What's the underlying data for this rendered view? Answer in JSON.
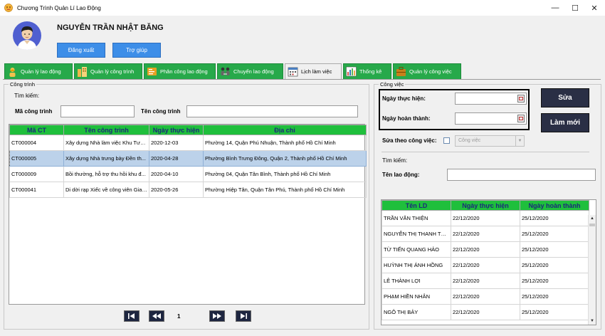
{
  "window": {
    "title": "Chương Trình Quản Lí Lao Động",
    "minimize": "—",
    "maximize": "☐",
    "close": "✕"
  },
  "header": {
    "user_name": "NGUYỄN TRẦN NHẬT BĂNG",
    "logout_label": "Đăng xuất",
    "help_label": "Trợ giúp"
  },
  "tabs": [
    {
      "label": "Quản lý lao động",
      "icon": "worker-icon",
      "active": false
    },
    {
      "label": "Quản lý công trình",
      "icon": "building-icon",
      "active": false
    },
    {
      "label": "Phân công lao động",
      "icon": "assign-icon",
      "active": false
    },
    {
      "label": "Chuyển lao động",
      "icon": "transfer-icon",
      "active": false
    },
    {
      "label": "Lịch làm việc",
      "icon": "calendar-icon",
      "active": true
    },
    {
      "label": "Thống kê",
      "icon": "chart-icon",
      "active": false
    },
    {
      "label": "Quản lý công việc",
      "icon": "briefcase-icon",
      "active": false
    }
  ],
  "left": {
    "group_title": "Công trình",
    "search_label": "Tìm kiếm:",
    "code_label": "Mã công trình",
    "code_value": "",
    "name_label": "Tên công trình",
    "name_value": "",
    "columns": [
      "Mã CT",
      "Tên công trình",
      "Ngày thực hiện",
      "Địa chỉ"
    ],
    "rows": [
      [
        "CT000004",
        "Xây dựng Nhà làm việc Khu Tưở...",
        "2020-12-03",
        "Phường 14, Quận Phú Nhuận, Thành phố Hồ Chí Minh"
      ],
      [
        "CT000005",
        "Xây dựng Nhà trưng bày Đền th...",
        "2020-04-28",
        "Phường Bình Trưng Đông, Quận 2, Thành phố Hồ Chí Minh"
      ],
      [
        "CT000009",
        "Bồi thường, hỗ trợ thu hồi khu đ...",
        "2020-04-10",
        "Phường 04, Quận Tân Bình, Thành phố Hồ Chí Minh"
      ],
      [
        "CT000041",
        "Di dời rạp Xiếc về công viên Gia ...",
        "2020-05-26",
        "Phường Hiệp Tân, Quận Tân Phú, Thành phố Hồ Chí Minh"
      ]
    ],
    "selected_row": 1,
    "page_number": "1"
  },
  "right": {
    "group_title": "Công việc",
    "start_label": "Ngày thực hiện:",
    "start_value": "",
    "end_label": "Ngày hoàn thành:",
    "end_value": "",
    "save_label": "Sửa",
    "refresh_label": "Làm mới",
    "by_job_label": "Sửa theo công việc:",
    "job_placeholder": "Công việc",
    "search_label": "Tìm kiếm:",
    "worker_name_label": "Tên lao động:",
    "worker_name_value": "",
    "columns": [
      "Tên LD",
      "Ngày thực hiện",
      "Ngày hoàn thành"
    ],
    "rows": [
      [
        "TRẦN VĂN THIỆN",
        "22/12/2020",
        "25/12/2020"
      ],
      [
        "NGUYỄN THỊ THANH TH...",
        "22/12/2020",
        "25/12/2020"
      ],
      [
        "TỪ TIẾN QUANG HẢO",
        "22/12/2020",
        "25/12/2020"
      ],
      [
        "HUỲNH THỊ ÁNH HỒNG",
        "22/12/2020",
        "25/12/2020"
      ],
      [
        "LÊ THÀNH LỢI",
        "22/12/2020",
        "25/12/2020"
      ],
      [
        "PHẠM HIỀN NHÂN",
        "22/12/2020",
        "25/12/2020"
      ],
      [
        "NGÔ THỊ BẢY",
        "22/12/2020",
        "25/12/2020"
      ]
    ]
  },
  "colors": {
    "tab_green": "#27a94a",
    "header_green": "#1fbf3c",
    "accent_blue": "#3d8ee8",
    "dark_button": "#2a2f45",
    "selection": "#bcd2ea"
  }
}
